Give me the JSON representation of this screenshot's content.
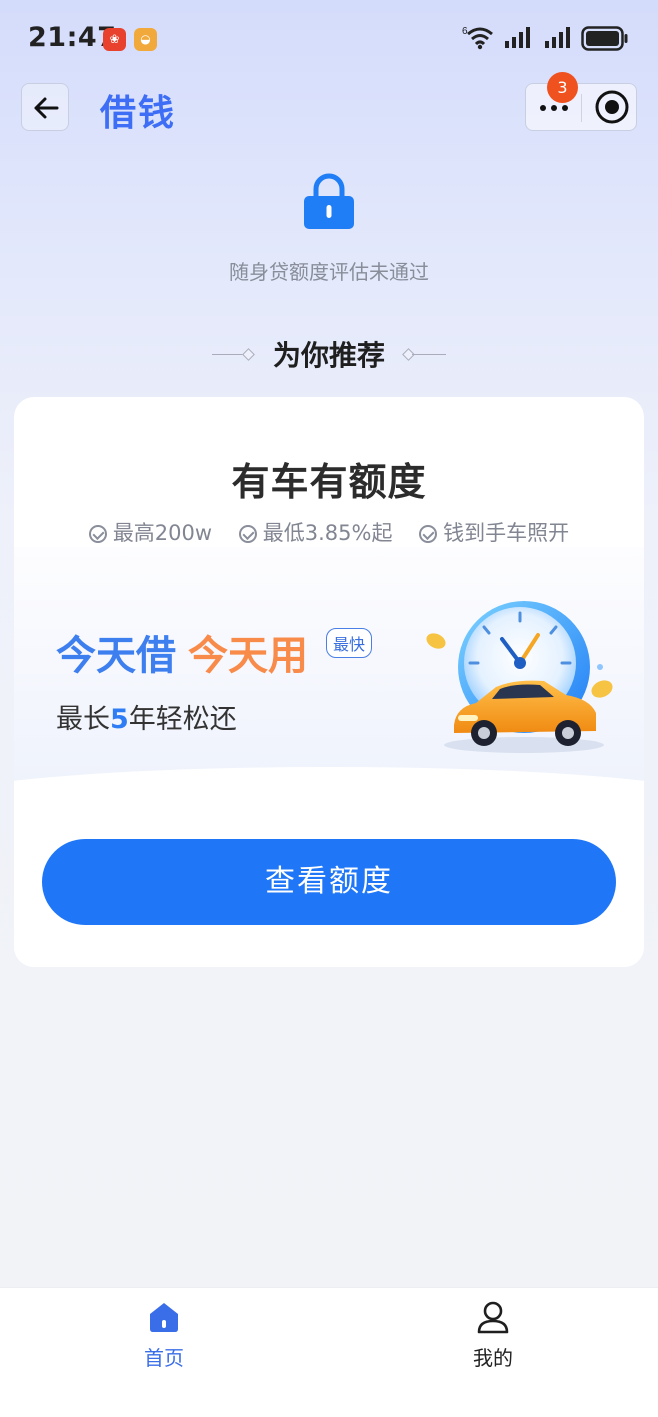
{
  "status_bar": {
    "time": "21:47",
    "app_icons": [
      "douyin-shop-icon",
      "notification-app-icon"
    ],
    "indicators": [
      "wifi-6-icon",
      "signal-icon",
      "signal-icon",
      "battery-icon"
    ],
    "wifi_label": "6"
  },
  "header": {
    "back_icon": "arrow-left-icon",
    "title": "借钱",
    "more_icon": "more-dots-icon",
    "close_icon": "target-circle-icon",
    "notification_count": "3"
  },
  "status_notice": {
    "icon": "lock-icon",
    "text": "随身贷额度评估未通过"
  },
  "recommend": {
    "title": "为你推荐"
  },
  "card": {
    "title": "有车有额度",
    "features": [
      "最高200w",
      "最低3.85%起",
      "钱到手车照开"
    ],
    "slogan_part1": "今天借",
    "slogan_part2": "今天用",
    "badge": "最快",
    "subline_prefix": "最长",
    "subline_highlight": "5",
    "subline_suffix": "年轻松还",
    "illustration": "car-speedometer-illustration",
    "cta_label": "查看额度"
  },
  "tabbar": {
    "items": [
      {
        "label": "首页",
        "icon": "home-icon",
        "active": true
      },
      {
        "label": "我的",
        "icon": "user-icon",
        "active": false
      }
    ]
  },
  "colors": {
    "accent": "#3d6ef5",
    "cta": "#1f77f7",
    "orange": "#f88a4a",
    "badge": "#f0521f"
  }
}
